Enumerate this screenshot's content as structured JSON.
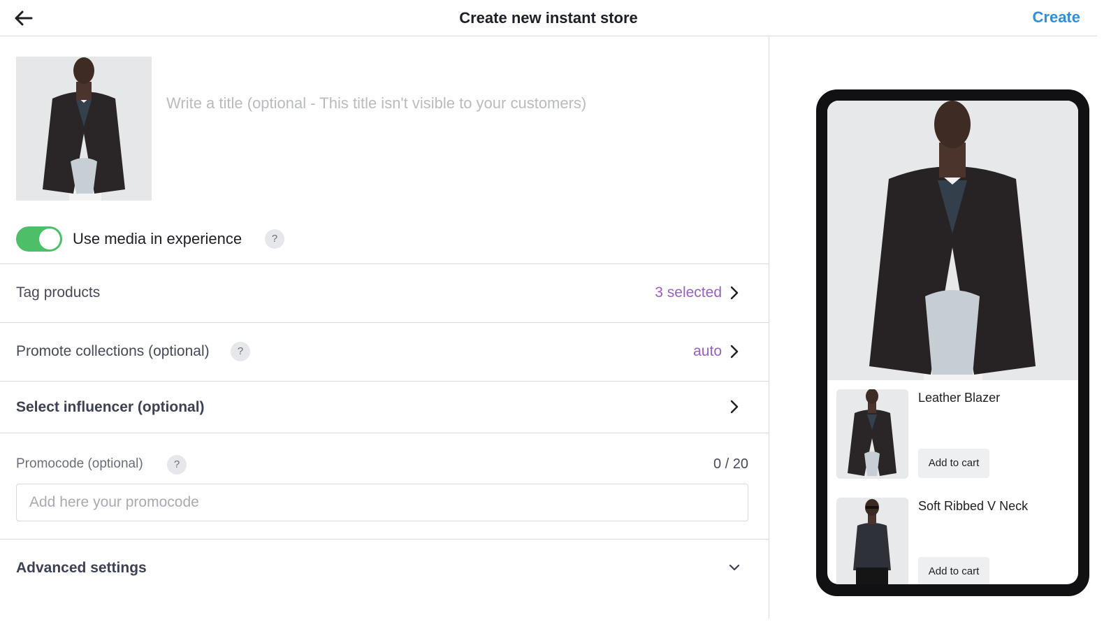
{
  "header": {
    "title": "Create new instant store",
    "create_label": "Create"
  },
  "editor": {
    "title_placeholder": "Write a title (optional - This title isn't visible to your customers)",
    "use_media": {
      "label": "Use media in experience",
      "enabled": true,
      "help": "?"
    },
    "tag_products": {
      "label": "Tag products",
      "value": "3 selected"
    },
    "promote_collections": {
      "label": "Promote collections (optional)",
      "help": "?",
      "value": "auto"
    },
    "select_influencer": {
      "label": "Select influencer (optional)"
    },
    "promocode": {
      "label": "Promocode (optional)",
      "help": "?",
      "counter": "0 / 20",
      "placeholder": "Add here your promocode"
    },
    "advanced": {
      "label": "Advanced settings"
    }
  },
  "preview": {
    "products": [
      {
        "name": "Leather Blazer",
        "button": "Add to cart"
      },
      {
        "name": "Soft Ribbed V Neck",
        "button": "Add to cart"
      }
    ]
  },
  "colors": {
    "accent_blue": "#2f8fd8",
    "toggle_green": "#4cbf68",
    "value_purple": "#9a5fc2"
  },
  "icons": {
    "back": "arrow-left-icon",
    "row": "chevron-right-icon",
    "advanced": "chevron-down-icon"
  }
}
